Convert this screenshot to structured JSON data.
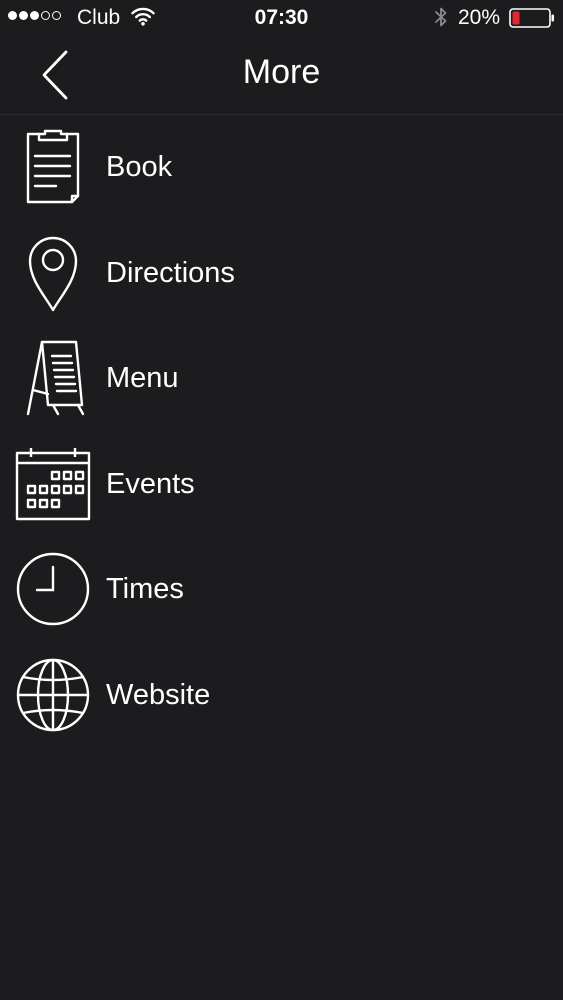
{
  "status_bar": {
    "carrier": "Club",
    "time": "07:30",
    "battery_percent": "20%",
    "battery_level": 0.2,
    "signal_bars_filled": 3,
    "signal_bars_total": 5,
    "battery_color": "#e0282e"
  },
  "nav": {
    "title": "More",
    "back_icon": "chevron-left-icon"
  },
  "menu": {
    "items": [
      {
        "label": "Book",
        "icon": "clipboard-icon"
      },
      {
        "label": "Directions",
        "icon": "map-pin-icon"
      },
      {
        "label": "Menu",
        "icon": "menu-board-icon"
      },
      {
        "label": "Events",
        "icon": "calendar-icon"
      },
      {
        "label": "Times",
        "icon": "clock-icon"
      },
      {
        "label": "Website",
        "icon": "globe-icon"
      }
    ]
  },
  "colors": {
    "background": "#1c1b1d",
    "foreground": "#ffffff"
  }
}
